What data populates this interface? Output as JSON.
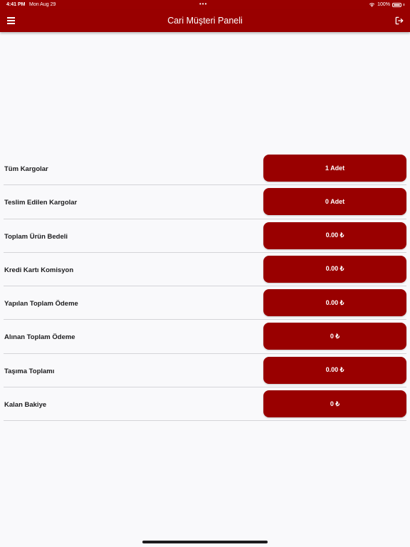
{
  "status_bar": {
    "time": "4:41 PM",
    "date": "Mon Aug 29",
    "dots": "•••",
    "battery": "100%"
  },
  "nav": {
    "title": "Cari Müşteri Paneli",
    "menu_icon": "hamburger-menu-icon",
    "logout_icon": "logout-icon"
  },
  "rows": [
    {
      "label": "Tüm Kargolar",
      "value": "1 Adet"
    },
    {
      "label": "Teslim Edilen Kargolar",
      "value": "0 Adet"
    },
    {
      "label": "Toplam Ürün Bedeli",
      "value": "0.00 ₺"
    },
    {
      "label": "Kredi Kartı Komisyon",
      "value": "0.00 ₺"
    },
    {
      "label": "Yapılan Toplam Ödeme",
      "value": "0.00 ₺"
    },
    {
      "label": "Alınan Toplam Ödeme",
      "value": "0 ₺"
    },
    {
      "label": "Taşıma Toplamı",
      "value": "0.00 ₺"
    },
    {
      "label": "Kalan Bakiye",
      "value": "0 ₺"
    }
  ],
  "colors": {
    "primary": "#990000",
    "background": "#f9f9fb",
    "text": "#1c1c1e"
  }
}
